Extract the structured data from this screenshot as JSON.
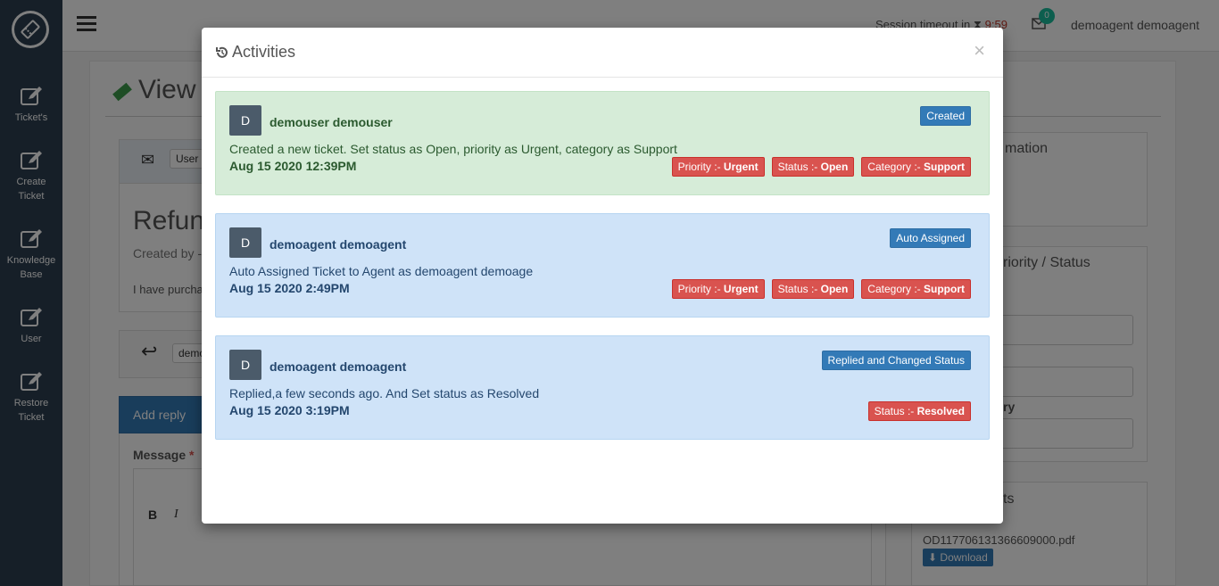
{
  "sidebar": {
    "items": [
      {
        "label_line1": "Ticket's",
        "label_line2": ""
      },
      {
        "label_line1": "Create",
        "label_line2": "Ticket"
      },
      {
        "label_line1": "Knowledge",
        "label_line2": "Base"
      },
      {
        "label_line1": "User",
        "label_line2": ""
      },
      {
        "label_line1": "Restore",
        "label_line2": "Ticket"
      }
    ]
  },
  "header": {
    "session_label": "Session timeout in",
    "session_time": "9:59",
    "mail_count": "0",
    "user_name": "demoagent demoagent"
  },
  "background": {
    "page_title": "View",
    "ticket_title": "Refun",
    "created_by": "Created by - I",
    "body_text": "I have purcha",
    "user_tab": "User",
    "reply_input": "demo",
    "add_reply": "Add reply",
    "message_label": "Message",
    "message_required": "*",
    "info_panel": "mation",
    "priority_status_panel": "riority / Status",
    "category_label": "ry",
    "attachments_panel": "ts",
    "attachment_file": "OD117706131366609000.pdf",
    "download_label": "Download"
  },
  "modal": {
    "title": "Activities",
    "close": "×",
    "activities": [
      {
        "avatar": "D",
        "user": "demouser demouser",
        "type": "Created",
        "message": "Created a new ticket. Set status as Open, priority as Urgent, category as Support",
        "date": "Aug 15 2020 12:39PM",
        "tags": [
          {
            "label": "Priority :-",
            "value": "Urgent"
          },
          {
            "label": "Status :-",
            "value": "Open"
          },
          {
            "label": "Category :-",
            "value": "Support"
          }
        ]
      },
      {
        "avatar": "D",
        "user": "demoagent demoagent",
        "type": "Auto Assigned",
        "message": "Auto Assigned Ticket to Agent as demoagent demoage",
        "date": "Aug 15 2020 2:49PM",
        "tags": [
          {
            "label": "Priority :-",
            "value": "Urgent"
          },
          {
            "label": "Status :-",
            "value": "Open"
          },
          {
            "label": "Category :-",
            "value": "Support"
          }
        ]
      },
      {
        "avatar": "D",
        "user": "demoagent demoagent",
        "type": "Replied and Changed Status",
        "message": "Replied,a few seconds ago. And Set status as Resolved",
        "date": "Aug 15 2020 3:19PM",
        "tags": [
          {
            "label": "Status :-",
            "value": "Resolved"
          }
        ]
      }
    ]
  },
  "colors": {
    "sidebar": "#2c3e50",
    "green_panel": "#d6ecd8",
    "blue_panel": "#cfe3f8",
    "primary_badge": "#337ab7",
    "danger_badge": "#d9534f"
  }
}
